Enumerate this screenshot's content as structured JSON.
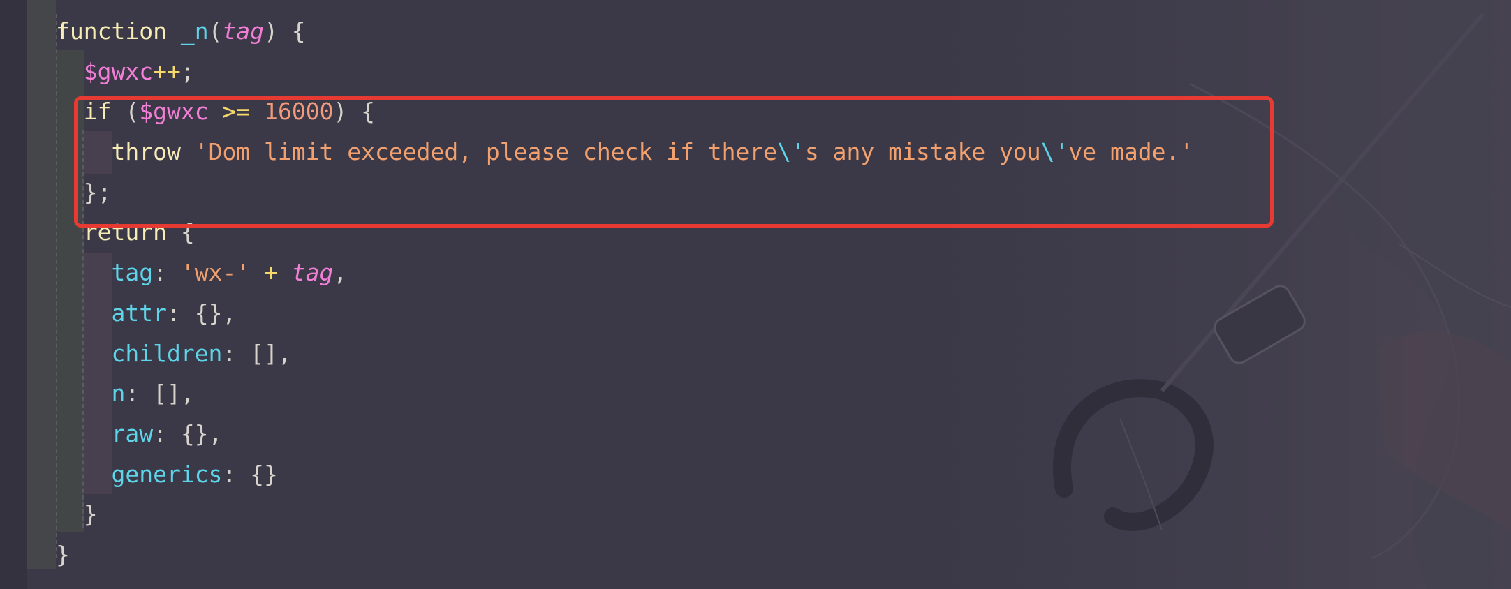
{
  "editor": {
    "lines": [
      {
        "indent": 0,
        "tokens": [
          {
            "t": "function",
            "c": "kw"
          },
          {
            "t": " ",
            "c": "punc"
          },
          {
            "t": "_n",
            "c": "fn"
          },
          {
            "t": "(",
            "c": "punc"
          },
          {
            "t": "tag",
            "c": "param"
          },
          {
            "t": ") {",
            "c": "punc"
          }
        ]
      },
      {
        "indent": 1,
        "tokens": [
          {
            "t": "$gwxc",
            "c": "var"
          },
          {
            "t": "++",
            "c": "op"
          },
          {
            "t": ";",
            "c": "punc"
          }
        ]
      },
      {
        "indent": 1,
        "tokens": [
          {
            "t": "if",
            "c": "kw"
          },
          {
            "t": " (",
            "c": "punc"
          },
          {
            "t": "$gwxc",
            "c": "var"
          },
          {
            "t": " ",
            "c": "punc"
          },
          {
            "t": ">=",
            "c": "op"
          },
          {
            "t": " ",
            "c": "punc"
          },
          {
            "t": "16000",
            "c": "num"
          },
          {
            "t": ") {",
            "c": "punc"
          }
        ]
      },
      {
        "indent": 2,
        "tokens": [
          {
            "t": "throw",
            "c": "kw"
          },
          {
            "t": " ",
            "c": "punc"
          },
          {
            "t": "'Dom limit exceeded, please check if there",
            "c": "str"
          },
          {
            "t": "\\'",
            "c": "esc"
          },
          {
            "t": "s any mistake you",
            "c": "str"
          },
          {
            "t": "\\'",
            "c": "esc"
          },
          {
            "t": "ve made.'",
            "c": "str"
          }
        ]
      },
      {
        "indent": 1,
        "tokens": [
          {
            "t": "};",
            "c": "punc"
          }
        ]
      },
      {
        "indent": 1,
        "tokens": [
          {
            "t": "return",
            "c": "kw"
          },
          {
            "t": " {",
            "c": "punc"
          }
        ]
      },
      {
        "indent": 2,
        "tokens": [
          {
            "t": "tag",
            "c": "prop"
          },
          {
            "t": ": ",
            "c": "punc"
          },
          {
            "t": "'wx-'",
            "c": "str"
          },
          {
            "t": " ",
            "c": "punc"
          },
          {
            "t": "+",
            "c": "op"
          },
          {
            "t": " ",
            "c": "punc"
          },
          {
            "t": "tag",
            "c": "param"
          },
          {
            "t": ",",
            "c": "punc"
          }
        ]
      },
      {
        "indent": 2,
        "tokens": [
          {
            "t": "attr",
            "c": "prop"
          },
          {
            "t": ": {},",
            "c": "punc"
          }
        ]
      },
      {
        "indent": 2,
        "tokens": [
          {
            "t": "children",
            "c": "prop"
          },
          {
            "t": ": [],",
            "c": "punc"
          }
        ]
      },
      {
        "indent": 2,
        "tokens": [
          {
            "t": "n",
            "c": "prop"
          },
          {
            "t": ": [],",
            "c": "punc"
          }
        ]
      },
      {
        "indent": 2,
        "tokens": [
          {
            "t": "raw",
            "c": "prop"
          },
          {
            "t": ": {},",
            "c": "punc"
          }
        ]
      },
      {
        "indent": 2,
        "tokens": [
          {
            "t": "generics",
            "c": "prop"
          },
          {
            "t": ": {}",
            "c": "punc"
          }
        ]
      },
      {
        "indent": 1,
        "tokens": [
          {
            "t": "}",
            "c": "punc"
          }
        ]
      },
      {
        "indent": 0,
        "tokens": [
          {
            "t": "}",
            "c": "punc"
          }
        ]
      }
    ]
  },
  "annotation": {
    "box_color": "#e63a32"
  },
  "colors": {
    "background": "#3a3847",
    "keyword": "#f7ecb5",
    "function": "#5ed4e8",
    "parameter": "#f27fd5",
    "string": "#f2a16e",
    "number": "#f39a7a"
  }
}
